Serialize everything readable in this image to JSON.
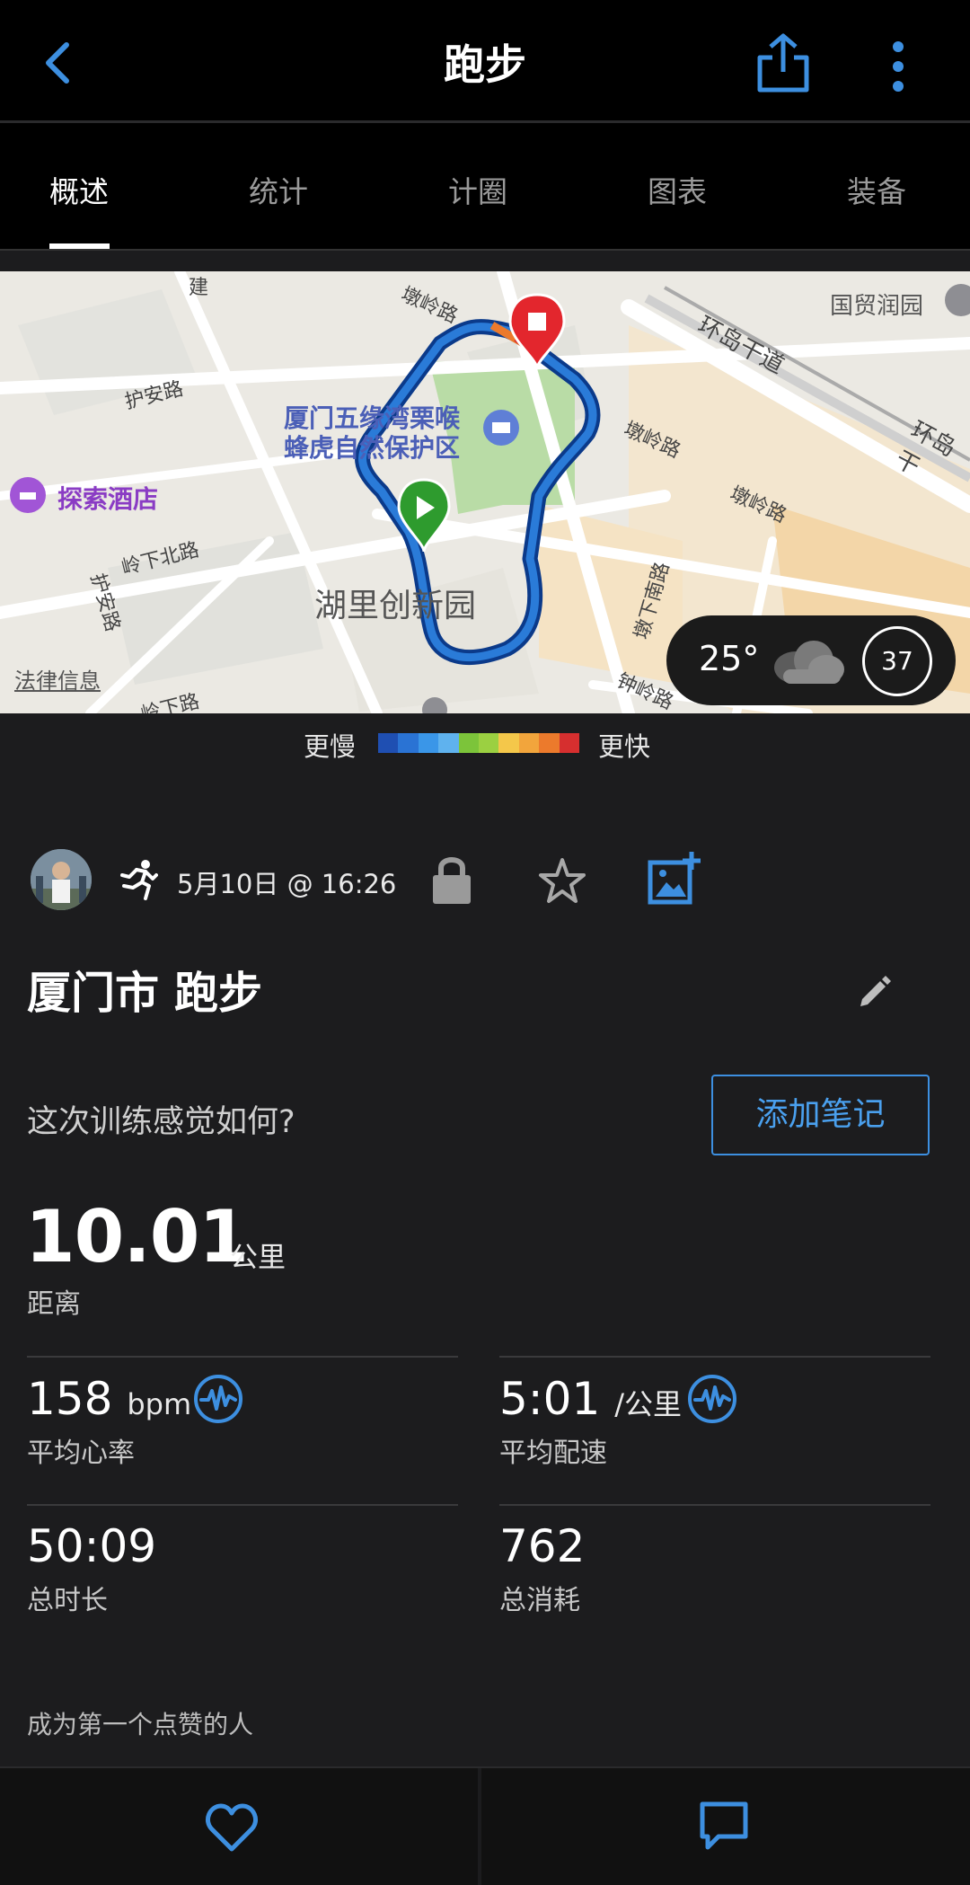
{
  "header": {
    "title": "跑步",
    "back_icon": "chevron-left-icon",
    "share_icon": "share-icon",
    "more_icon": "more-vertical-icon"
  },
  "tabs": [
    {
      "label": "概述",
      "active": true
    },
    {
      "label": "统计",
      "active": false
    },
    {
      "label": "计圈",
      "active": false
    },
    {
      "label": "图表",
      "active": false
    },
    {
      "label": "装备",
      "active": false
    }
  ],
  "map": {
    "labels": {
      "park": "厦门五缘湾栗喉",
      "park2": "蜂虎自然保护区",
      "hotel": "探索酒店",
      "innovation": "湖里创新园",
      "legal": "法律信息",
      "guomao": "国贸润园",
      "huandao": "环岛干道",
      "huandao2": "环岛干",
      "dunling": "墩岭路",
      "dunling2": "墩岭路",
      "dunling3": "墩岭路",
      "huan": "护安路",
      "huan2": "护安路",
      "lingxia": "岭下北路",
      "lingxia2": "岭下路",
      "zhongling": "钟岭路",
      "dunxia": "墩下南路",
      "jian": "建"
    },
    "weather": {
      "temperature": "25°",
      "aqi": "37",
      "weather_icon": "cloudy-icon"
    }
  },
  "legend": {
    "slower": "更慢",
    "faster": "更快",
    "colors": [
      "#1f4fb2",
      "#2a73d4",
      "#3a96e8",
      "#5fb2ee",
      "#7cc43a",
      "#9bd041",
      "#f4c74a",
      "#f2a53c",
      "#ec7a2c",
      "#d62f2f"
    ]
  },
  "activity": {
    "datetime": "5月10日 @ 16:26",
    "title": "厦门市 跑步",
    "question": "这次训练感觉如何?",
    "add_note": "添加笔记",
    "distance": {
      "value": "10.01",
      "unit": "公里",
      "label": "距离"
    },
    "avg_hr": {
      "value": "158",
      "unit": "bpm",
      "label": "平均心率"
    },
    "avg_pace": {
      "value": "5:01",
      "unit": "/公里",
      "label": "平均配速"
    },
    "duration": {
      "value": "50:09",
      "label": "总时长"
    },
    "calories": {
      "value": "762",
      "label": "总消耗"
    },
    "likes_text": "成为第一个点赞的人"
  },
  "colors": {
    "accent": "#3d8fe0",
    "background": "#1c1c1e"
  }
}
